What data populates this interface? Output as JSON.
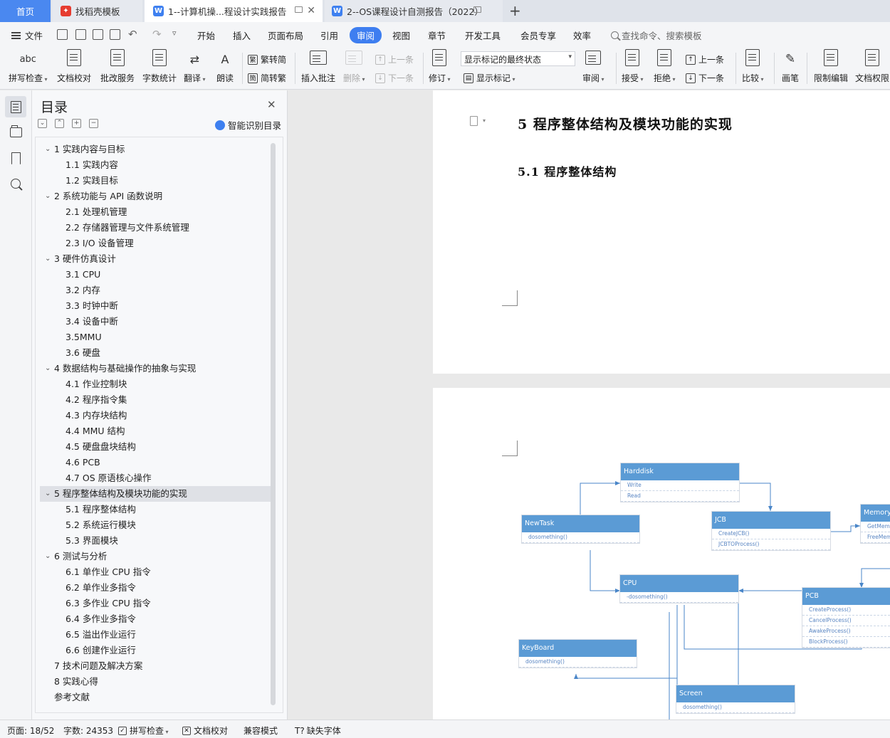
{
  "tabs": {
    "home": "首页",
    "template": "找稻壳模板",
    "doc1": "1--计算机操...程设计实践报告",
    "doc2": "2--OS课程设计自测报告（2022）",
    "add": "+"
  },
  "menu": {
    "file": "文件",
    "items": [
      "开始",
      "插入",
      "页面布局",
      "引用",
      "审阅",
      "视图",
      "章节",
      "开发工具",
      "会员专享",
      "效率"
    ],
    "active": "审阅",
    "search_placeholder": "查找命令、搜索模板"
  },
  "ribbon": {
    "spell_check": "拼写检查",
    "doc_proof": "文档校对",
    "correction_service": "批改服务",
    "word_count": "字数统计",
    "translate": "翻译",
    "read_aloud": "朗读",
    "trad_to_simp_1": "繁转简",
    "simp_to_trad": "简转繁",
    "insert_comment": "插入批注",
    "delete": "删除",
    "prev_comment": "上一条",
    "next_comment": "下一条",
    "track_changes": "修订",
    "markup_mode": "显示标记的最终状态",
    "show_markup": "显示标记",
    "review": "审阅",
    "accept": "接受",
    "reject": "拒绝",
    "prev_change": "上一条",
    "next_change": "下一条",
    "compare": "比较",
    "pen": "画笔",
    "restrict_edit": "限制编辑",
    "doc_permission": "文档权限",
    "abc_icon": "abc"
  },
  "toc": {
    "title": "目录",
    "smart": "智能识别目录",
    "items": [
      {
        "text": "1  实践内容与目标",
        "level": 1
      },
      {
        "text": "1.1 实践内容",
        "level": 2
      },
      {
        "text": "1.2 实践目标",
        "level": 2
      },
      {
        "text": "2  系统功能与  API  函数说明",
        "level": 1
      },
      {
        "text": "2.1 处理机管理",
        "level": 2
      },
      {
        "text": "2.2  存储器管理与文件系统管理",
        "level": 2
      },
      {
        "text": "2.3 I/O 设备管理",
        "level": 2
      },
      {
        "text": "3  硬件仿真设计",
        "level": 1
      },
      {
        "text": "3.1 CPU",
        "level": 2
      },
      {
        "text": "3.2 内存",
        "level": 2
      },
      {
        "text": "3.3 时钟中断",
        "level": 2
      },
      {
        "text": "3.4 设备中断",
        "level": 2
      },
      {
        "text": "3.5MMU",
        "level": 2
      },
      {
        "text": "3.6 硬盘",
        "level": 2
      },
      {
        "text": "4  数据结构与基础操作的抽象与实现",
        "level": 1
      },
      {
        "text": "4.1  作业控制块",
        "level": 2
      },
      {
        "text": "4.2  程序指令集",
        "level": 2
      },
      {
        "text": "4.3  内存块结构",
        "level": 2
      },
      {
        "text": "4.4    MMU 结构",
        "level": 2
      },
      {
        "text": "4.5  硬盘盘块结构",
        "level": 2
      },
      {
        "text": "4.6 PCB",
        "level": 2
      },
      {
        "text": "4.7 OS 原语核心操作",
        "level": 2
      },
      {
        "text": "5  程序整体结构及模块功能的实现",
        "level": 1
      },
      {
        "text": "5.1  程序整体结构",
        "level": 2
      },
      {
        "text": "5.2  系统运行模块",
        "level": 2
      },
      {
        "text": "5.3  界面模块",
        "level": 2
      },
      {
        "text": "6  测试与分析",
        "level": 1
      },
      {
        "text": "6.1  单作业 CPU 指令",
        "level": 2
      },
      {
        "text": "6.2  单作业多指令",
        "level": 2
      },
      {
        "text": "6.3  多作业 CPU 指令",
        "level": 2
      },
      {
        "text": "6.4  多作业多指令",
        "level": 2
      },
      {
        "text": "6.5  溢出作业运行",
        "level": 2
      },
      {
        "text": "6.6  创建作业运行",
        "level": 2
      },
      {
        "text": "7  技术问题及解决方案",
        "level": 0
      },
      {
        "text": "8  实践心得",
        "level": 0
      },
      {
        "text": "参考文献",
        "level": 0
      }
    ],
    "active_index": 22
  },
  "document": {
    "heading1": "5  程序整体结构及模块功能的实现",
    "heading2": "5.1  程序整体结构"
  },
  "uml": {
    "harddisk": {
      "name": "Harddisk",
      "methods": [
        "Write",
        "Read"
      ]
    },
    "newtask": {
      "name": "NewTask",
      "methods": [
        "dosomething()"
      ]
    },
    "jcb": {
      "name": "JCB",
      "methods": [
        "CreateJCB()",
        "JCBTOProcess()"
      ]
    },
    "memory": {
      "name": "Memory",
      "methods": [
        "GetMem",
        "FreeMem"
      ]
    },
    "cpu": {
      "name": "CPU",
      "methods": [
        "-dosomething()"
      ]
    },
    "pcb": {
      "name": "PCB",
      "methods": [
        "CreateProcess()",
        "CancelProcess()",
        "AwakeProcess()",
        "BlockProcess()"
      ]
    },
    "keyboard": {
      "name": "KeyBoard",
      "methods": [
        "dosomething()"
      ]
    },
    "screen": {
      "name": "Screen",
      "methods": [
        "dosomething()"
      ]
    }
  },
  "status": {
    "page": "页面: 18/52",
    "words": "字数: 24353",
    "spell": "拼写检查",
    "proof": "文档校对",
    "compat": "兼容模式",
    "missing_font": "缺失字体"
  },
  "colors": {
    "accent": "#3e7ef0",
    "uml_header": "#5b9bd5",
    "uml_wire": "#4a86c8"
  }
}
